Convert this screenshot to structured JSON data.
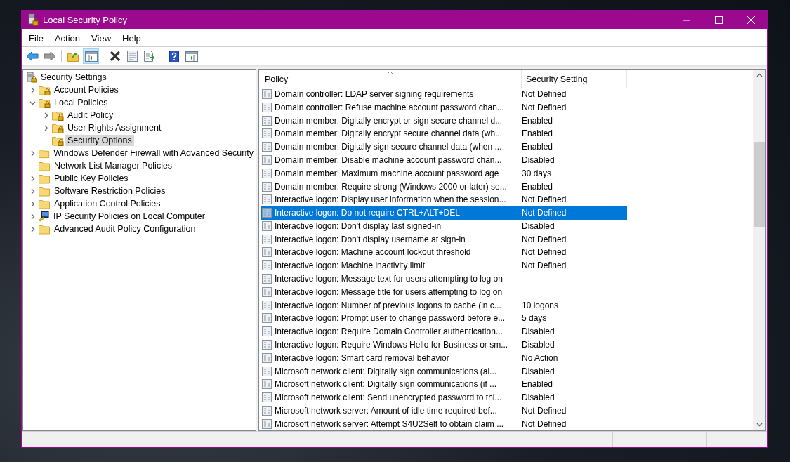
{
  "window": {
    "title": "Local Security Policy"
  },
  "menu": [
    "File",
    "Action",
    "View",
    "Help"
  ],
  "toolbar": [
    {
      "kind": "back",
      "pressed": false
    },
    {
      "kind": "forward",
      "pressed": false
    },
    {
      "kind": "separator"
    },
    {
      "kind": "up",
      "pressed": false
    },
    {
      "kind": "tree",
      "pressed": true
    },
    {
      "kind": "separator"
    },
    {
      "kind": "delete",
      "pressed": false
    },
    {
      "kind": "properties",
      "pressed": false
    },
    {
      "kind": "export",
      "pressed": false
    },
    {
      "kind": "separator"
    },
    {
      "kind": "help",
      "pressed": false
    },
    {
      "kind": "pane",
      "pressed": false
    }
  ],
  "tree": {
    "label": "Security Settings",
    "kind": "root",
    "children": [
      {
        "label": "Account Policies",
        "kind": "locked",
        "expandable": true,
        "expanded": false,
        "selected": false
      },
      {
        "label": "Local Policies",
        "kind": "locked",
        "expandable": true,
        "expanded": true,
        "selected": false,
        "children": [
          {
            "label": "Audit Policy",
            "kind": "locked",
            "expandable": true,
            "expanded": false,
            "selected": false
          },
          {
            "label": "User Rights Assignment",
            "kind": "locked",
            "expandable": true,
            "expanded": false,
            "selected": false
          },
          {
            "label": "Security Options",
            "kind": "locked",
            "expandable": false,
            "selected": true
          }
        ]
      },
      {
        "label": "Windows Defender Firewall with Advanced Security",
        "kind": "folder",
        "expandable": true,
        "expanded": false,
        "selected": false
      },
      {
        "label": "Network List Manager Policies",
        "kind": "folder",
        "expandable": false,
        "selected": false
      },
      {
        "label": "Public Key Policies",
        "kind": "folder",
        "expandable": true,
        "expanded": false,
        "selected": false
      },
      {
        "label": "Software Restriction Policies",
        "kind": "folder",
        "expandable": true,
        "expanded": false,
        "selected": false
      },
      {
        "label": "Application Control Policies",
        "kind": "folder",
        "expandable": true,
        "expanded": false,
        "selected": false
      },
      {
        "label": "IP Security Policies on Local Computer",
        "kind": "computer",
        "expandable": true,
        "expanded": false,
        "selected": false
      },
      {
        "label": "Advanced Audit Policy Configuration",
        "kind": "folder",
        "expandable": true,
        "expanded": false,
        "selected": false
      }
    ]
  },
  "table": {
    "columns": [
      "Policy",
      "Security Setting"
    ],
    "rows": [
      {
        "policy": "Domain controller: LDAP server signing requirements",
        "setting": "Not Defined",
        "selected": false
      },
      {
        "policy": "Domain controller: Refuse machine account password chan...",
        "setting": "Not Defined",
        "selected": false
      },
      {
        "policy": "Domain member: Digitally encrypt or sign secure channel d...",
        "setting": "Enabled",
        "selected": false
      },
      {
        "policy": "Domain member: Digitally encrypt secure channel data (wh...",
        "setting": "Enabled",
        "selected": false
      },
      {
        "policy": "Domain member: Digitally sign secure channel data (when ...",
        "setting": "Enabled",
        "selected": false
      },
      {
        "policy": "Domain member: Disable machine account password chan...",
        "setting": "Disabled",
        "selected": false
      },
      {
        "policy": "Domain member: Maximum machine account password age",
        "setting": "30 days",
        "selected": false
      },
      {
        "policy": "Domain member: Require strong (Windows 2000 or later) se...",
        "setting": "Enabled",
        "selected": false
      },
      {
        "policy": "Interactive logon: Display user information when the session...",
        "setting": "Not Defined",
        "selected": false
      },
      {
        "policy": "Interactive logon: Do not require CTRL+ALT+DEL",
        "setting": "Not Defined",
        "selected": true
      },
      {
        "policy": "Interactive logon: Don't display last signed-in",
        "setting": "Disabled",
        "selected": false
      },
      {
        "policy": "Interactive logon: Don't display username at sign-in",
        "setting": "Not Defined",
        "selected": false
      },
      {
        "policy": "Interactive logon: Machine account lockout threshold",
        "setting": "Not Defined",
        "selected": false
      },
      {
        "policy": "Interactive logon: Machine inactivity limit",
        "setting": "Not Defined",
        "selected": false
      },
      {
        "policy": "Interactive logon: Message text for users attempting to log on",
        "selected": false
      },
      {
        "policy": "Interactive logon: Message title for users attempting to log on",
        "selected": false
      },
      {
        "policy": "Interactive logon: Number of previous logons to cache (in c...",
        "setting": "10 logons",
        "selected": false
      },
      {
        "policy": "Interactive logon: Prompt user to change password before e...",
        "setting": "5 days",
        "selected": false
      },
      {
        "policy": "Interactive logon: Require Domain Controller authentication...",
        "setting": "Disabled",
        "selected": false
      },
      {
        "policy": "Interactive logon: Require Windows Hello for Business or sm...",
        "setting": "Disabled",
        "selected": false
      },
      {
        "policy": "Interactive logon: Smart card removal behavior",
        "setting": "No Action",
        "selected": false
      },
      {
        "policy": "Microsoft network client: Digitally sign communications (al...",
        "setting": "Disabled",
        "selected": false
      },
      {
        "policy": "Microsoft network client: Digitally sign communications (if ...",
        "setting": "Enabled",
        "selected": false
      },
      {
        "policy": "Microsoft network client: Send unencrypted password to thi...",
        "setting": "Disabled",
        "selected": false
      },
      {
        "policy": "Microsoft network server: Amount of idle time required bef...",
        "setting": "Not Defined",
        "selected": false
      },
      {
        "policy": "Microsoft network server: Attempt S4U2Self to obtain claim ...",
        "setting": "Not Defined",
        "selected": false
      }
    ]
  }
}
